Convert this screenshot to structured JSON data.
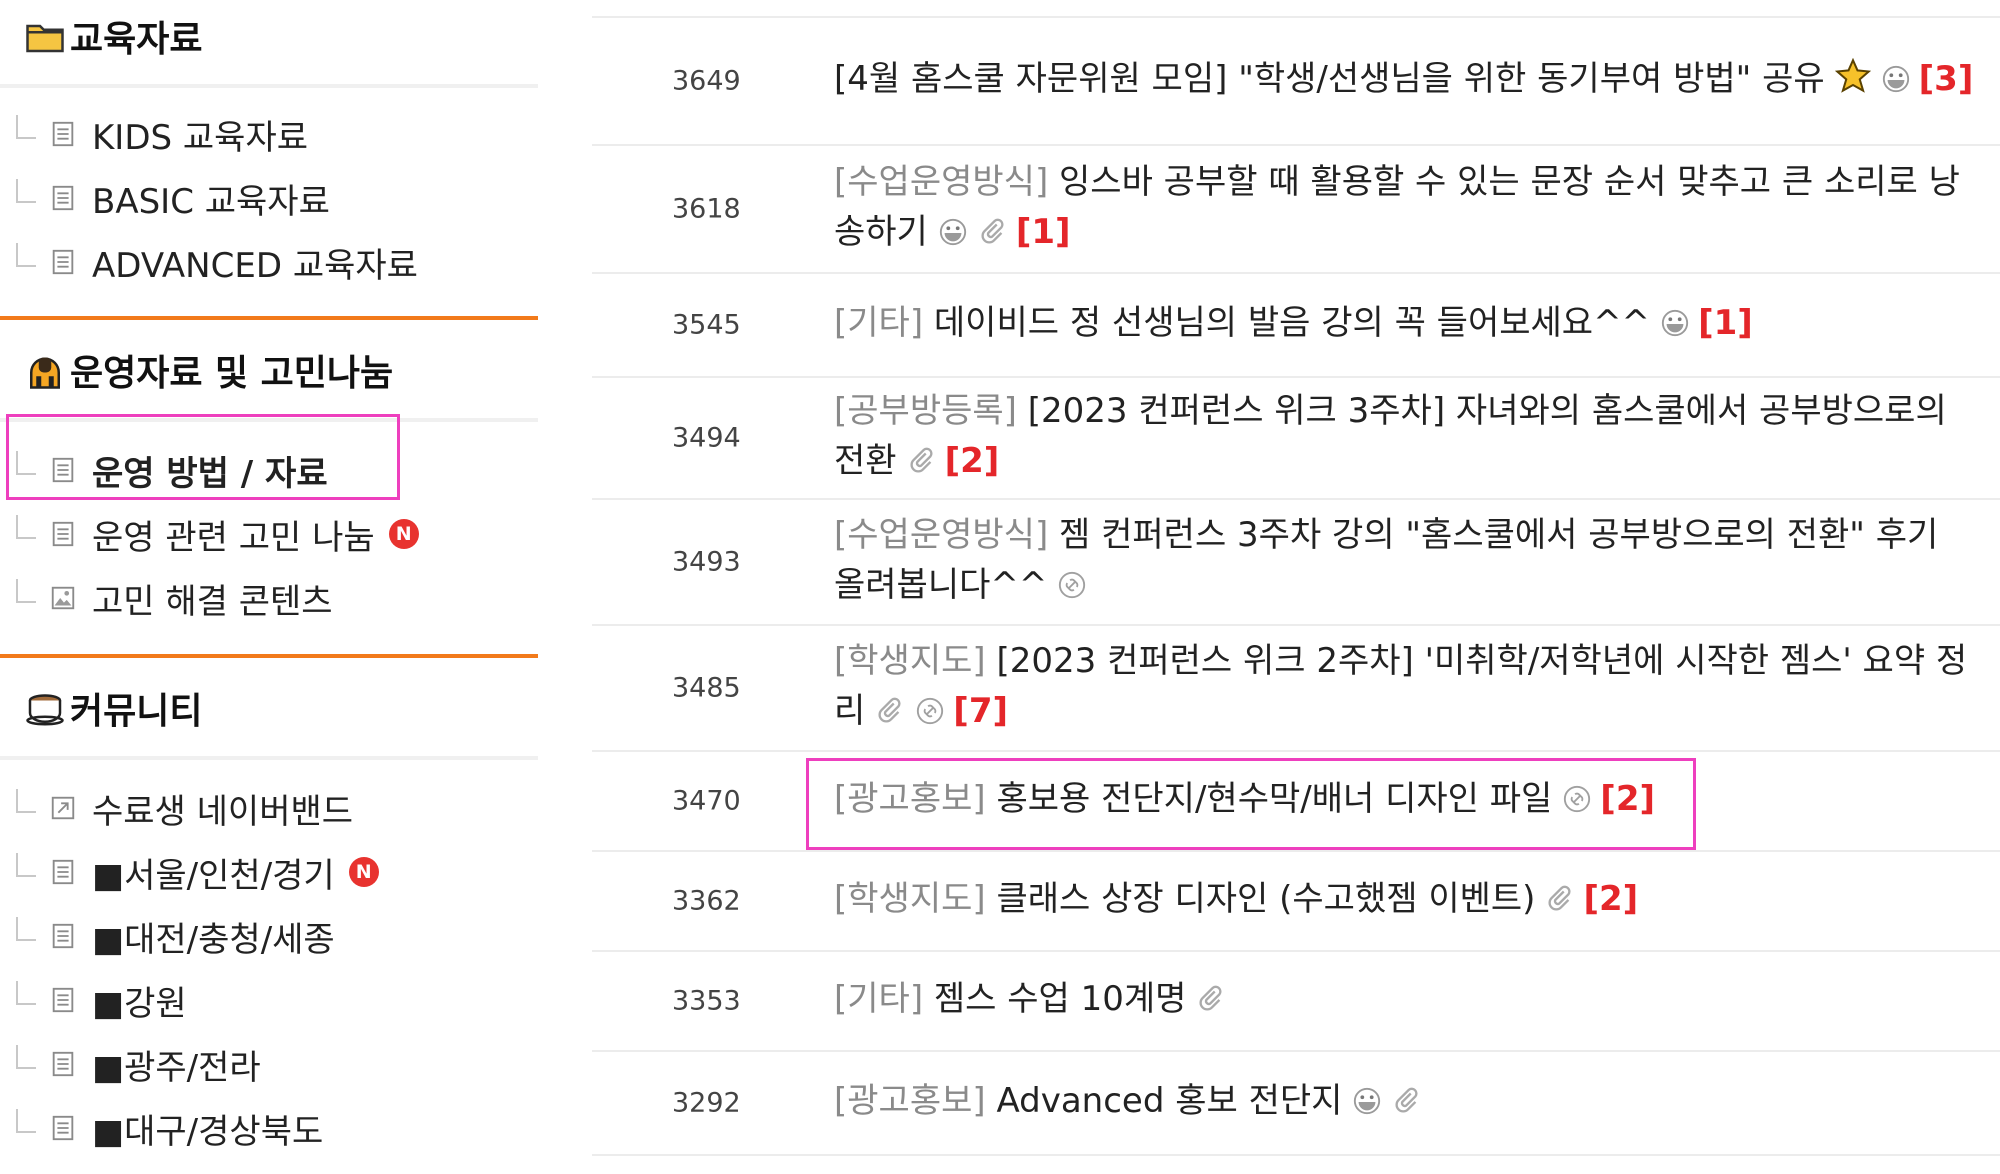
{
  "sidebar": {
    "sections": [
      {
        "title": "교육자료",
        "icon": "folder-icon",
        "items": [
          {
            "label": "KIDS 교육자료",
            "icon": "board-icon"
          },
          {
            "label": "BASIC 교육자료",
            "icon": "board-icon"
          },
          {
            "label": "ADVANCED 교육자료",
            "icon": "board-icon"
          }
        ]
      },
      {
        "title": "운영자료 및 고민나눔",
        "icon": "person-icon",
        "items": [
          {
            "label": "운영 방법 / 자료",
            "icon": "board-icon",
            "selected": true
          },
          {
            "label": "운영 관련 고민 나눔",
            "icon": "board-icon",
            "badge": "N"
          },
          {
            "label": "고민 해결 콘텐츠",
            "icon": "album-icon"
          }
        ]
      },
      {
        "title": "커뮤니티",
        "icon": "coffee-cup-icon",
        "items": [
          {
            "label": "수료생 네이버밴드",
            "icon": "link-icon"
          },
          {
            "label": "■서울/인천/경기",
            "icon": "board-icon",
            "badge": "N"
          },
          {
            "label": "■대전/충청/세종",
            "icon": "board-icon"
          },
          {
            "label": "■강원",
            "icon": "board-icon"
          },
          {
            "label": "■광주/전라",
            "icon": "board-icon"
          },
          {
            "label": "■대구/경상북도",
            "icon": "board-icon"
          }
        ]
      }
    ]
  },
  "posts": [
    {
      "num": "3649",
      "category": "",
      "title": "[4월 홈스쿨 자문위원 모임] \"학생/선생님을 위한 동기부여 방법\" 공유",
      "icons": [
        "star-icon",
        "face-icon"
      ],
      "comments": "[3]"
    },
    {
      "num": "3618",
      "category": "[수업운영방식]",
      "title": "잉스바 공부할 때 활용할 수 있는 문장 순서 맞추고 큰 소리로 낭송하기",
      "icons": [
        "face-icon",
        "attachment-icon"
      ],
      "comments": "[1]"
    },
    {
      "num": "3545",
      "category": "[기타]",
      "title": "데이비드 정 선생님의 발음 강의 꼭 들어보세요^^",
      "icons": [
        "face-icon"
      ],
      "comments": "[1]"
    },
    {
      "num": "3494",
      "category": "[공부방등록]",
      "title": "[2023 컨퍼런스 위크 3주차] 자녀와의 홈스쿨에서 공부방으로의 전환",
      "icons": [
        "attachment-icon"
      ],
      "comments": "[2]"
    },
    {
      "num": "3493",
      "category": "[수업운영방식]",
      "title": "젬 컨퍼런스 3주차 강의 \"홈스쿨에서 공부방으로의 전환\" 후기 올려봅니다^^",
      "icons": [
        "link-circle-icon"
      ],
      "comments": ""
    },
    {
      "num": "3485",
      "category": "[학생지도]",
      "title": "[2023 컨퍼런스 위크 2주차] '미취학/저학년에 시작한 젬스' 요약 정리",
      "icons": [
        "attachment-icon",
        "link-circle-icon"
      ],
      "comments": "[7]"
    },
    {
      "num": "3470",
      "category": "[광고홍보]",
      "title": "홍보용 전단지/현수막/배너 디자인 파일",
      "icons": [
        "link-circle-icon"
      ],
      "comments": "[2]",
      "highlighted": true
    },
    {
      "num": "3362",
      "category": "[학생지도]",
      "title": "클래스 상장 디자인 (수고했젬 이벤트)",
      "icons": [
        "attachment-icon"
      ],
      "comments": "[2]"
    },
    {
      "num": "3353",
      "category": "[기타]",
      "title": "젬스 수업 10계명",
      "icons": [
        "attachment-icon"
      ],
      "comments": ""
    },
    {
      "num": "3292",
      "category": "[광고홍보]",
      "title": "Advanced 홍보 전단지",
      "icons": [
        "face-icon",
        "attachment-icon"
      ],
      "comments": ""
    }
  ],
  "colors": {
    "accent_orange": "#f27a1a",
    "comment_red": "#e4262a",
    "highlight_pink": "#ee3fbe",
    "new_badge_red": "#e8332f",
    "category_gray": "#8a8a8a"
  }
}
